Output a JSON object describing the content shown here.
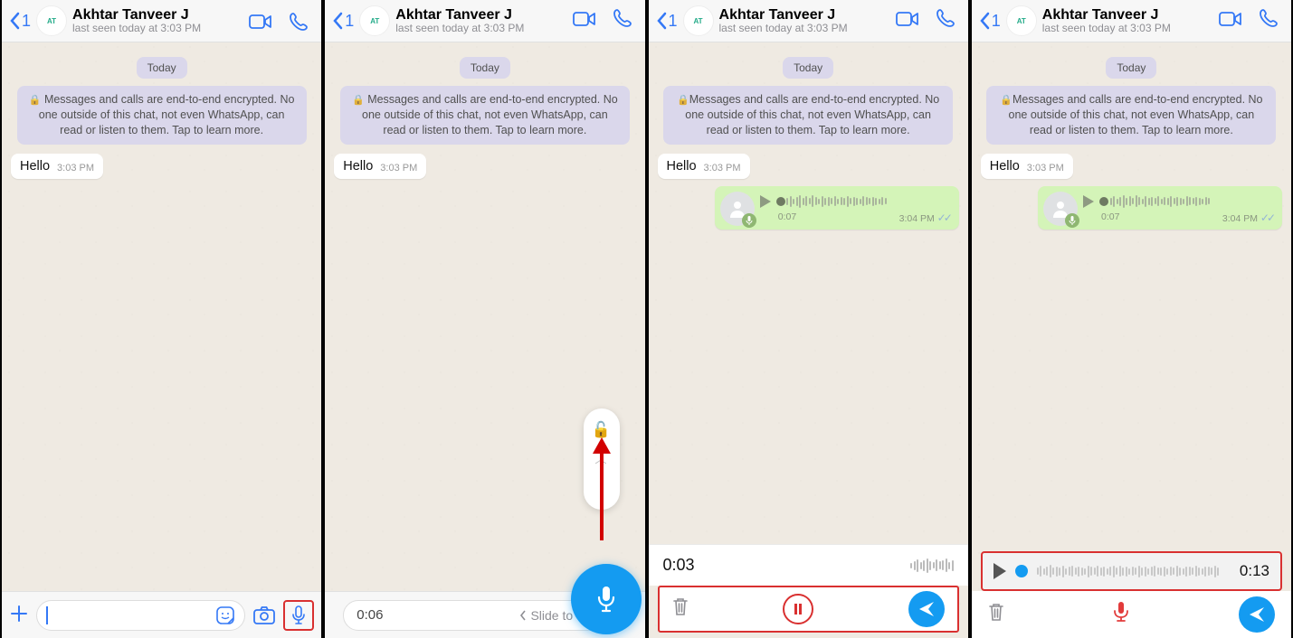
{
  "contact": {
    "name": "Akhtar Tanveer J",
    "status": "last seen today at 3:03 PM",
    "avatar_text": "AT"
  },
  "back_count": "1",
  "date_label": "Today",
  "encryption_notice": "Messages and calls are end-to-end encrypted. No one outside of this chat, not even WhatsApp, can read or listen to them. Tap to learn more.",
  "message_in": {
    "text": "Hello",
    "time": "3:03 PM"
  },
  "voice_msg": {
    "duration": "0:07",
    "time": "3:04 PM"
  },
  "panel2": {
    "rec_time": "0:06",
    "slide_text": "Slide to cancel"
  },
  "panel3": {
    "rec_time": "0:03"
  },
  "panel4": {
    "duration": "0:13"
  },
  "colors": {
    "accent": "#3478f6",
    "record_blue": "#149bf1",
    "highlight": "#d93030",
    "bubble_out": "#d4f4b8",
    "pill": "#dad7eb"
  }
}
